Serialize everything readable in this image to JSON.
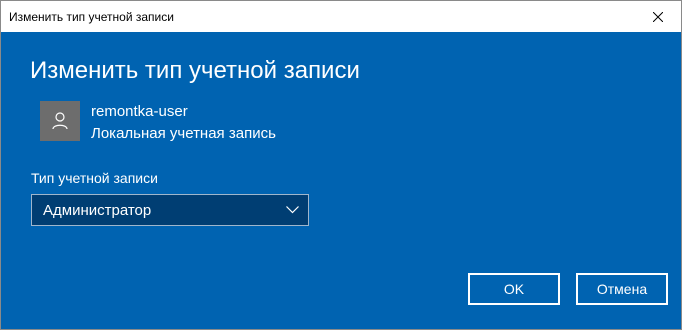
{
  "window": {
    "title": "Изменить тип учетной записи"
  },
  "dialog": {
    "heading": "Изменить тип учетной записи",
    "user": {
      "name": "remontka-user",
      "account_kind": "Локальная учетная запись",
      "avatar_icon": "user-icon"
    },
    "account_type": {
      "label": "Тип учетной записи",
      "selected": "Администратор"
    },
    "buttons": {
      "ok": "OK",
      "cancel": "Отмена"
    }
  },
  "colors": {
    "background": "#0063b1",
    "dropdown_bg": "#003e73",
    "avatar_bg": "#6d6d6d",
    "text": "#ffffff"
  }
}
